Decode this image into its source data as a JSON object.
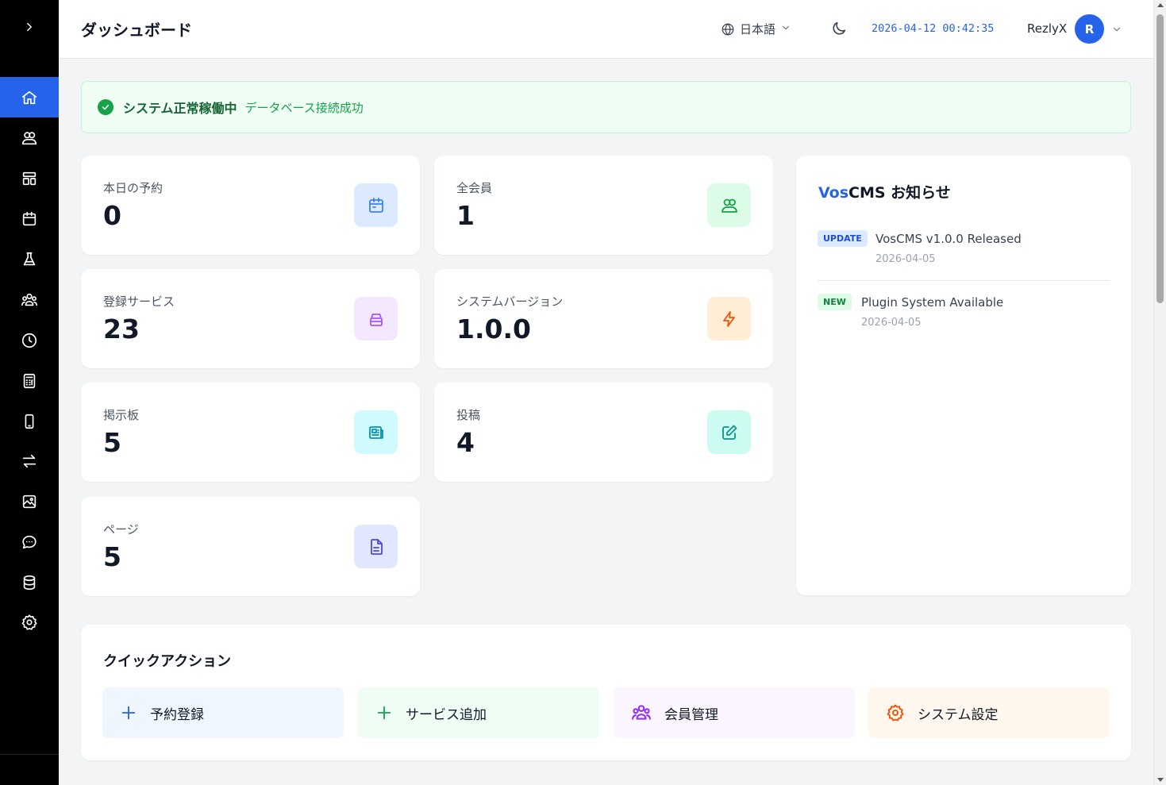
{
  "header": {
    "title": "ダッシュボード",
    "language": "日本語",
    "datetime": "2026-04-12 00:42:35",
    "username": "RezlyX",
    "avatar_initial": "R"
  },
  "status": {
    "main": "システム正常稼働中",
    "sub": "データベース接続成功"
  },
  "stats": [
    {
      "label": "本日の予約",
      "value": "0",
      "icon": "calendar-icon",
      "color": "#3b82f6",
      "bg": "#dbeafe"
    },
    {
      "label": "全会員",
      "value": "1",
      "icon": "users-icon",
      "color": "#16a34a",
      "bg": "#dcfce7"
    },
    {
      "label": "登録サービス",
      "value": "23",
      "icon": "box-icon",
      "color": "#a855f7",
      "bg": "#f3e8ff"
    },
    {
      "label": "システムバージョン",
      "value": "1.0.0",
      "icon": "bolt-icon",
      "color": "#ea580c",
      "bg": "#ffedd5"
    },
    {
      "label": "掲示板",
      "value": "5",
      "icon": "newspaper-icon",
      "color": "#0891b2",
      "bg": "#cffafe"
    },
    {
      "label": "投稿",
      "value": "4",
      "icon": "edit-icon",
      "color": "#0d9488",
      "bg": "#ccfbf1"
    },
    {
      "label": "ページ",
      "value": "5",
      "icon": "document-icon",
      "color": "#4f46e5",
      "bg": "#e0e7ff"
    }
  ],
  "news": {
    "title_brand": "Vos",
    "title_rest": "CMS お知らせ",
    "items": [
      {
        "badge": "UPDATE",
        "text": "VosCMS v1.0.0 Released",
        "date": "2026-04-05",
        "badge_color": "#1d4ed8",
        "badge_bg": "#dbeafe"
      },
      {
        "badge": "NEW",
        "text": "Plugin System Available",
        "date": "2026-04-05",
        "badge_color": "#15803d",
        "badge_bg": "#dcfce7"
      }
    ]
  },
  "quick_actions": {
    "title": "クイックアクション",
    "items": [
      {
        "label": "予約登録",
        "icon": "plus-icon",
        "color": "#2563eb",
        "bg": "#eff6ff"
      },
      {
        "label": "サービス追加",
        "icon": "plus-icon",
        "color": "#16a34a",
        "bg": "#f0fdf4"
      },
      {
        "label": "会員管理",
        "icon": "members-icon",
        "color": "#9333ea",
        "bg": "#faf5ff"
      },
      {
        "label": "システム設定",
        "icon": "gear-icon",
        "color": "#ea580c",
        "bg": "#fff7ed"
      }
    ]
  },
  "sidebar": {
    "items": [
      {
        "icon": "home-icon",
        "active": true
      },
      {
        "icon": "users-icon"
      },
      {
        "icon": "layout-icon"
      },
      {
        "icon": "calendar-icon"
      },
      {
        "icon": "flask-icon"
      },
      {
        "icon": "group-icon"
      },
      {
        "icon": "clock-icon"
      },
      {
        "icon": "calculator-icon"
      },
      {
        "icon": "mobile-icon"
      },
      {
        "icon": "transfer-icon"
      },
      {
        "icon": "image-icon"
      },
      {
        "icon": "chat-icon"
      },
      {
        "icon": "database-icon"
      },
      {
        "icon": "gear-icon"
      }
    ]
  }
}
